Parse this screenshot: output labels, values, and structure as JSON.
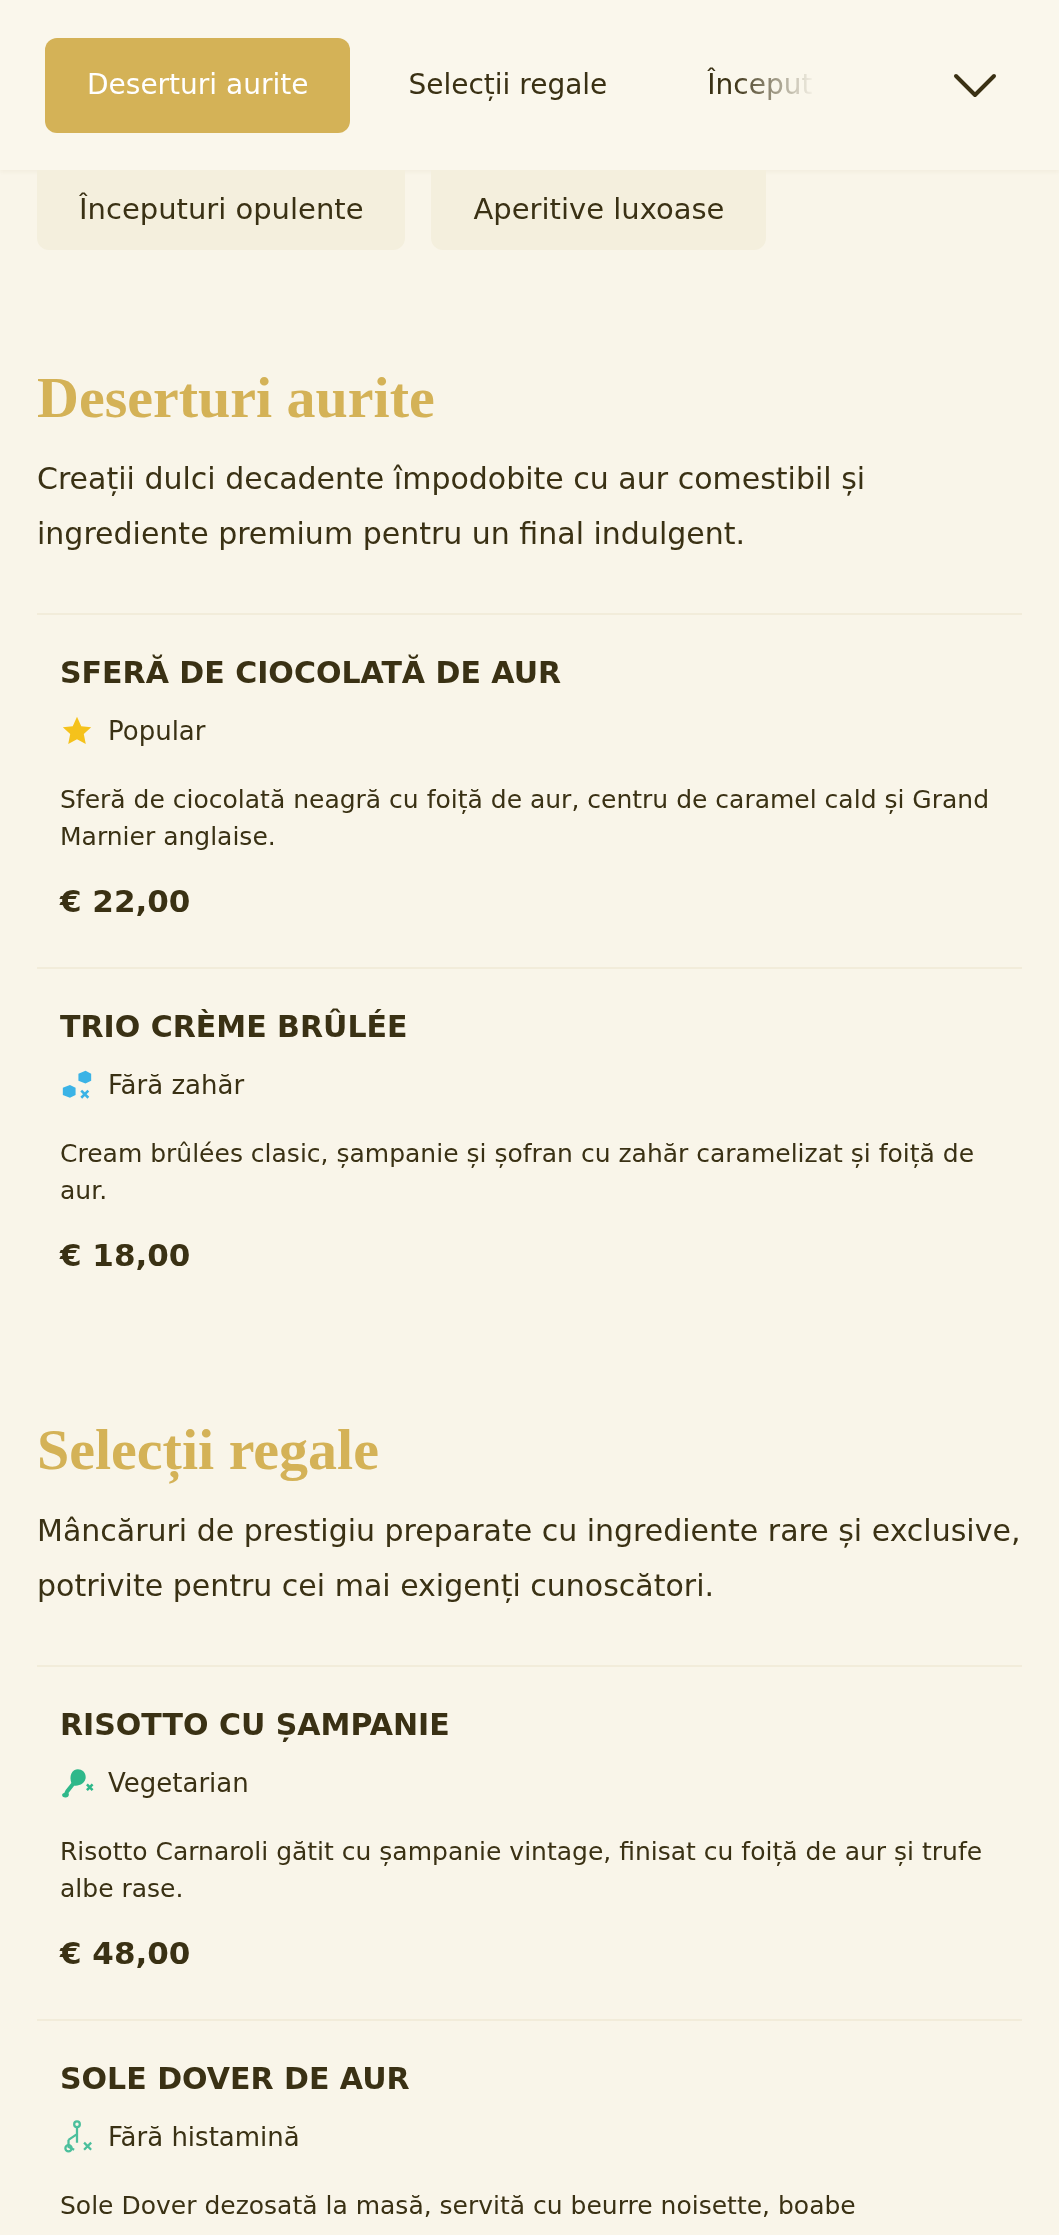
{
  "tabs": [
    {
      "label": "Deserturi aurite",
      "selected": true
    },
    {
      "label": "Selecții regale",
      "selected": false
    },
    {
      "label": "Început",
      "selected": false,
      "faded": true
    }
  ],
  "category_chips": [
    {
      "label": "Începuturi opulente"
    },
    {
      "label": "Aperitive luxoase"
    }
  ],
  "sections": [
    {
      "title": "Deserturi aurite",
      "description": "Creații dulci decadente împodobite cu aur comestibil și ingrediente premium pentru un final indulgent.",
      "items": [
        {
          "name": "SFERĂ DE CIOCOLATĂ DE AUR",
          "badge": {
            "kind": "star",
            "label": "Popular"
          },
          "description": "Sferă de ciocolată neagră cu foiță de aur, centru de caramel cald și Grand Marnier anglaise.",
          "price": "€ 22,00"
        },
        {
          "name": "TRIO CRÈME BRÛLÉE",
          "badge": {
            "kind": "sugar_free",
            "label": "Fără zahăr"
          },
          "description": "Cream brûlées clasic, șampanie și șofran cu zahăr caramelizat și foiță de aur.",
          "price": "€ 18,00"
        }
      ]
    },
    {
      "title": "Selecții regale",
      "description": "Mâncăruri de prestigiu preparate cu ingrediente rare și exclusive, potrivite pentru cei mai exigenți cunoscători.",
      "items": [
        {
          "name": "RISOTTO CU ȘAMPANIE",
          "badge": {
            "kind": "vegetarian",
            "label": "Vegetarian"
          },
          "description": "Risotto Carnaroli gătit cu șampanie vintage, finisat cu foiță de aur și trufe albe rase.",
          "price": "€ 48,00"
        },
        {
          "name": "SOLE DOVER DE AUR",
          "badge": {
            "kind": "histamine_free",
            "label": "Fără histamină"
          },
          "description": "Sole Dover dezosată la masă, servită cu beurre noisette, boabe"
        }
      ]
    }
  ]
}
